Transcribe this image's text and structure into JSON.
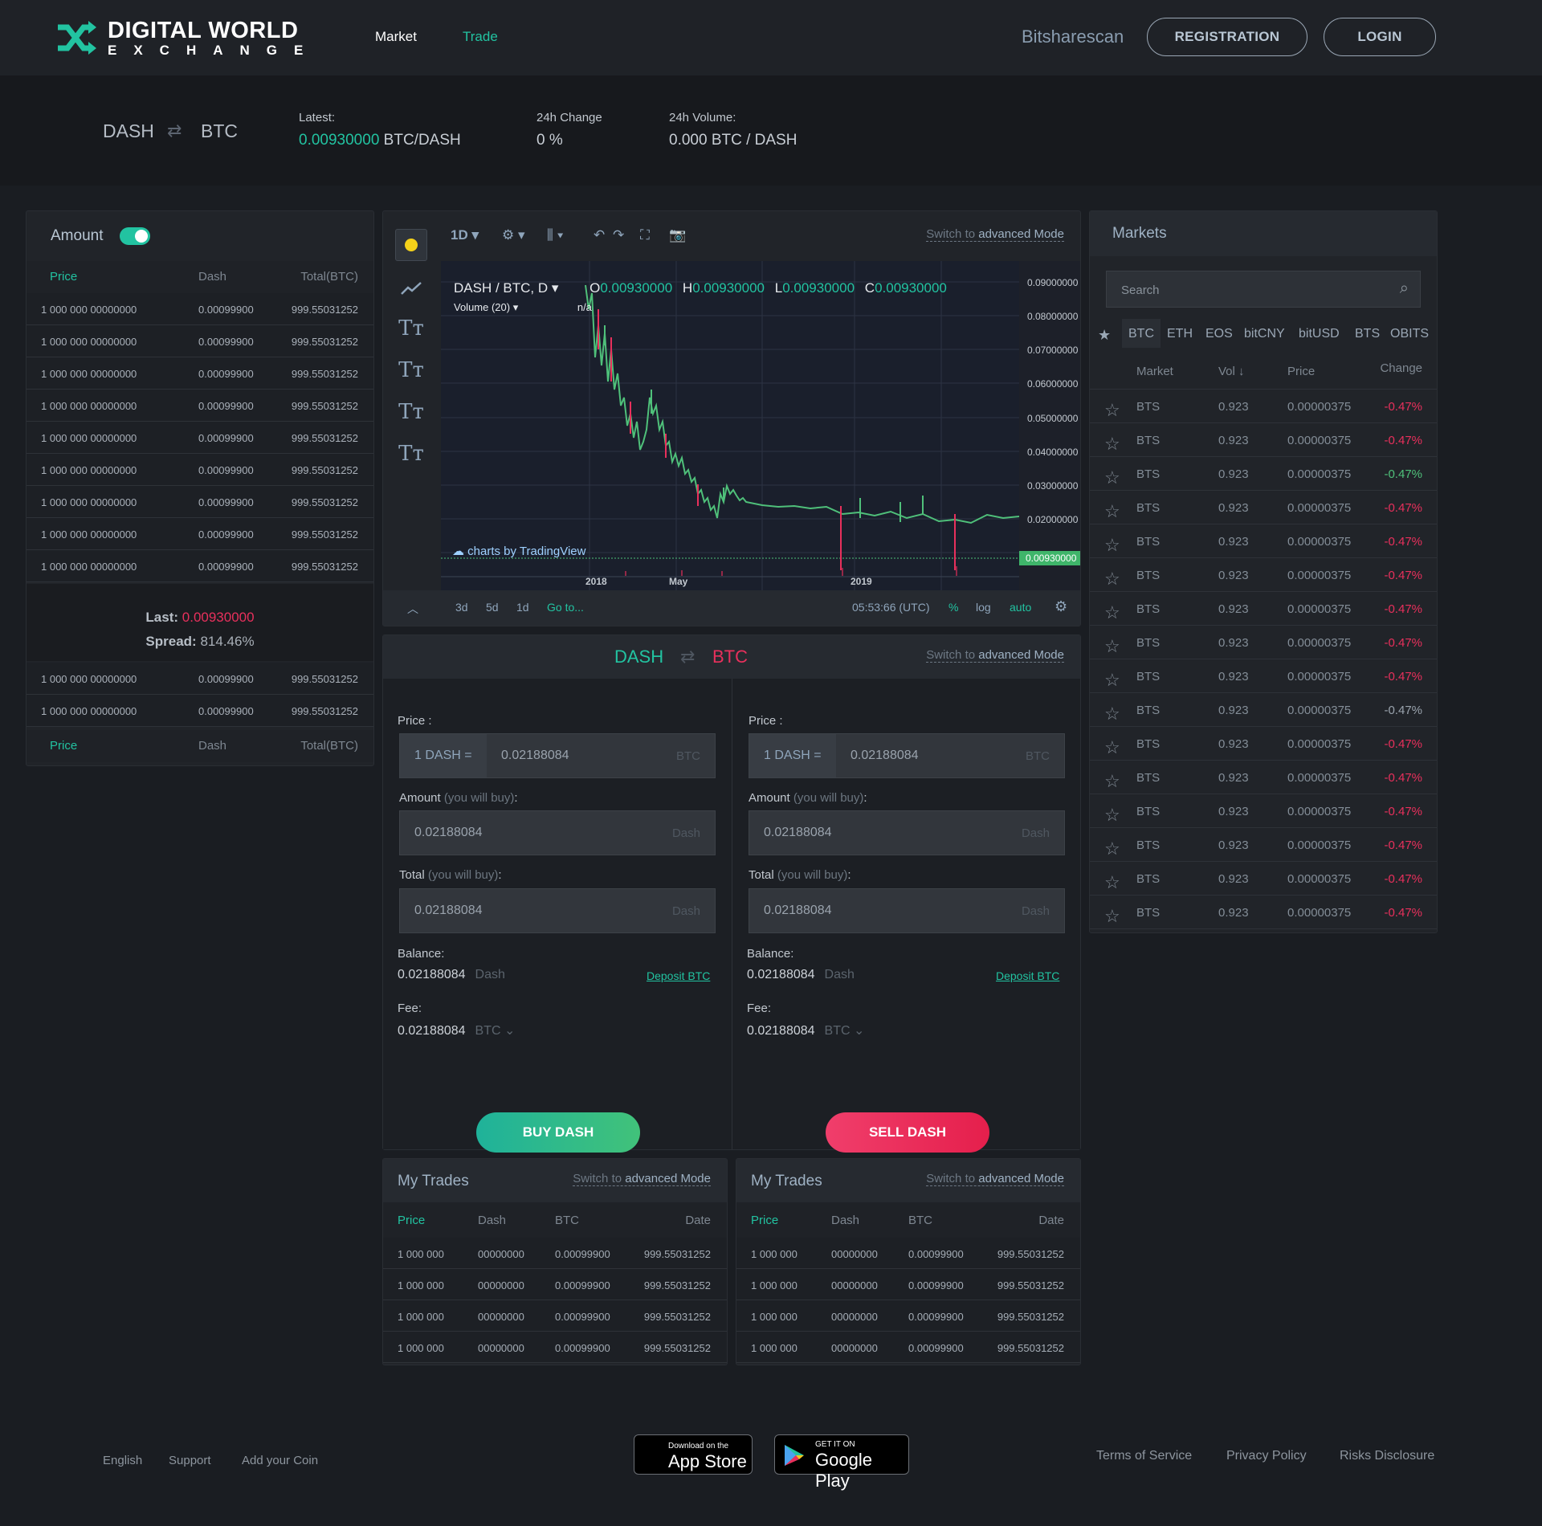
{
  "header": {
    "logo_line1": "DIGITAL WORLD",
    "logo_line2": "EXCHANGE",
    "nav": [
      "Market",
      "Trade"
    ],
    "bitsharescan": "Bitsharescan",
    "registration": "REGISTRATION",
    "login": "LOGIN"
  },
  "ticker": {
    "base": "DASH",
    "quote": "BTC",
    "latest_label": "Latest:",
    "latest_value": "0.00930000",
    "latest_unit": "BTC/DASH",
    "change_label": "24h Change",
    "change_value": "0 %",
    "volume_label": "24h Volume:",
    "volume_value": "0.000 BTC /  DASH"
  },
  "orderbook": {
    "title": "Amount",
    "col_price": "Price",
    "col_dash": "Dash",
    "col_total": "Total(BTC)",
    "rows_top": [
      [
        "1 000  000  00000000",
        "0.00099900",
        "999.55031252"
      ],
      [
        "1 000  000  00000000",
        "0.00099900",
        "999.55031252"
      ],
      [
        "1 000  000  00000000",
        "0.00099900",
        "999.55031252"
      ],
      [
        "1 000  000  00000000",
        "0.00099900",
        "999.55031252"
      ],
      [
        "1 000  000  00000000",
        "0.00099900",
        "999.55031252"
      ],
      [
        "1 000  000  00000000",
        "0.00099900",
        "999.55031252"
      ],
      [
        "1 000  000  00000000",
        "0.00099900",
        "999.55031252"
      ],
      [
        "1 000  000  00000000",
        "0.00099900",
        "999.55031252"
      ],
      [
        "1 000  000  00000000",
        "0.00099900",
        "999.55031252"
      ]
    ],
    "last_label": "Last:",
    "last_value": "0.00930000",
    "spread_label": "Spread:",
    "spread_value": "814.46%",
    "rows_bottom": [
      [
        "1 000  000  00000000",
        "0.00099900",
        "999.55031252"
      ],
      [
        "1 000  000  00000000",
        "0.00099900",
        "999.55031252"
      ]
    ]
  },
  "chart": {
    "interval": "1D",
    "switch_pre": "Switch to",
    "switch_link": "advanced Mode",
    "symbol": "DASH / BTC, D",
    "o": "0.00930000",
    "h": "0.00930000",
    "l": "0.00930000",
    "c": "0.00930000",
    "volume_label": "Volume (20)",
    "volume_value": "n/a",
    "watermark": "charts by TradingView",
    "y_ticks": [
      "0.09000000",
      "0.08000000",
      "0.07000000",
      "0.06000000",
      "0.05000000",
      "0.04000000",
      "0.03000000",
      "0.02000000"
    ],
    "last_price_tag": "0.00930000",
    "x_ticks": [
      "2018",
      "May",
      "2019"
    ],
    "footer": {
      "r3d": "3d",
      "r5d": "5d",
      "r1d": "1d",
      "goto": "Go to...",
      "time": "05:53:66 (UTC)",
      "pct": "%",
      "log": "log",
      "auto": "auto"
    }
  },
  "trade": {
    "base": "DASH",
    "quote": "BTC",
    "price_label": "Price :",
    "prefix": "1 DASH  =",
    "price_value": "0.02188084",
    "price_unit": "BTC",
    "amount_label": "Amount",
    "amount_hint": "(you will buy)",
    "amount_value": "0.02188084",
    "amount_unit": "Dash",
    "total_label": "Total",
    "total_hint": "(you will buy)",
    "total_value": "0.02188084",
    "total_unit": "Dash",
    "balance_label": "Balance:",
    "balance_value": "0.02188084",
    "balance_unit": "Dash",
    "deposit": "Deposit BTC",
    "fee_label": "Fee:",
    "fee_value": "0.02188084",
    "fee_unit": "BTC",
    "buy_label": "BUY DASH",
    "sell_label": "SELL DASH"
  },
  "mytrades": {
    "title": "My Trades",
    "cols": [
      "Price",
      "Dash",
      "BTC",
      "Date"
    ],
    "rows": [
      [
        "1  000  000",
        "00000000",
        "0.00099900",
        "999.55031252"
      ],
      [
        "1  000  000",
        "00000000",
        "0.00099900",
        "999.55031252"
      ],
      [
        "1  000  000",
        "00000000",
        "0.00099900",
        "999.55031252"
      ],
      [
        "1  000  000",
        "00000000",
        "0.00099900",
        "999.55031252"
      ]
    ]
  },
  "markets": {
    "title": "Markets",
    "search_placeholder": "Search",
    "tabs": [
      "BTC",
      "ETH",
      "EOS",
      "bitCNY",
      "bitUSD",
      "BTS",
      "OBITS"
    ],
    "cols": [
      "Market",
      "Vol ↓",
      "Price",
      "Change"
    ],
    "rows": [
      {
        "market": "BTS",
        "vol": "0.923",
        "price": "0.00000375",
        "change": "-0.47%",
        "color": "#e8305c"
      },
      {
        "market": "BTS",
        "vol": "0.923",
        "price": "0.00000375",
        "change": "-0.47%",
        "color": "#e8305c"
      },
      {
        "market": "BTS",
        "vol": "0.923",
        "price": "0.00000375",
        "change": "-0.47%",
        "color": "#4fc07a"
      },
      {
        "market": "BTS",
        "vol": "0.923",
        "price": "0.00000375",
        "change": "-0.47%",
        "color": "#e8305c"
      },
      {
        "market": "BTS",
        "vol": "0.923",
        "price": "0.00000375",
        "change": "-0.47%",
        "color": "#e8305c"
      },
      {
        "market": "BTS",
        "vol": "0.923",
        "price": "0.00000375",
        "change": "-0.47%",
        "color": "#e8305c"
      },
      {
        "market": "BTS",
        "vol": "0.923",
        "price": "0.00000375",
        "change": "-0.47%",
        "color": "#e8305c"
      },
      {
        "market": "BTS",
        "vol": "0.923",
        "price": "0.00000375",
        "change": "-0.47%",
        "color": "#e8305c"
      },
      {
        "market": "BTS",
        "vol": "0.923",
        "price": "0.00000375",
        "change": "-0.47%",
        "color": "#e8305c"
      },
      {
        "market": "BTS",
        "vol": "0.923",
        "price": "0.00000375",
        "change": "-0.47%",
        "color": "#9aa3ad"
      },
      {
        "market": "BTS",
        "vol": "0.923",
        "price": "0.00000375",
        "change": "-0.47%",
        "color": "#e8305c"
      },
      {
        "market": "BTS",
        "vol": "0.923",
        "price": "0.00000375",
        "change": "-0.47%",
        "color": "#e8305c"
      },
      {
        "market": "BTS",
        "vol": "0.923",
        "price": "0.00000375",
        "change": "-0.47%",
        "color": "#e8305c"
      },
      {
        "market": "BTS",
        "vol": "0.923",
        "price": "0.00000375",
        "change": "-0.47%",
        "color": "#e8305c"
      },
      {
        "market": "BTS",
        "vol": "0.923",
        "price": "0.00000375",
        "change": "-0.47%",
        "color": "#e8305c"
      },
      {
        "market": "BTS",
        "vol": "0.923",
        "price": "0.00000375",
        "change": "-0.47%",
        "color": "#e8305c"
      }
    ]
  },
  "footer": {
    "english": "English",
    "support": "Support",
    "add_coin": "Add your Coin",
    "appstore_small": "Download on the",
    "appstore_big": "App Store",
    "gplay_small": "GET IT ON",
    "gplay_big": "Google Play",
    "terms": "Terms of Service",
    "privacy": "Privacy Policy",
    "risks": "Risks Disclosure"
  }
}
